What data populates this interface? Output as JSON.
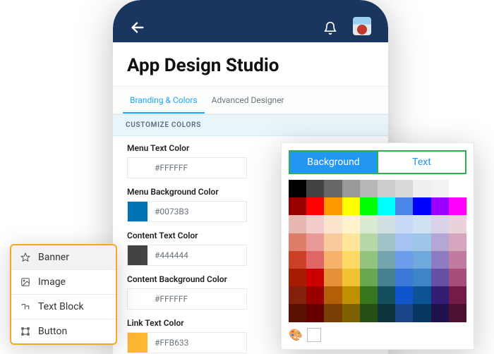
{
  "header": {
    "title": "App Design Studio"
  },
  "tabs": [
    {
      "label": "Branding & Colors",
      "active": true
    },
    {
      "label": "Advanced Designer",
      "active": false
    }
  ],
  "section_header": "CUSTOMIZE COLORS",
  "fields": [
    {
      "label": "Menu Text Color",
      "value": "#FFFFFF",
      "swatch": "#FFFFFF"
    },
    {
      "label": "Menu Background Color",
      "value": "#0073B3",
      "swatch": "#0073B3"
    },
    {
      "label": "Content Text Color",
      "value": "#444444",
      "swatch": "#444444"
    },
    {
      "label": "Content Background Color",
      "value": "#FFFFFF",
      "swatch": "#FFFFFF"
    },
    {
      "label": "Link Text Color",
      "value": "#FFB633",
      "swatch": "#FFB633"
    }
  ],
  "elements": [
    {
      "icon": "star-icon",
      "label": "Banner"
    },
    {
      "icon": "image-icon",
      "label": "Image"
    },
    {
      "icon": "text-icon",
      "label": "Text Block"
    },
    {
      "icon": "frame-icon",
      "label": "Button"
    }
  ],
  "picker": {
    "tabs": {
      "primary": "Background",
      "secondary": "Text"
    },
    "row1": [
      "#000000",
      "#434343",
      "#666666",
      "#999999",
      "#b7b7b7",
      "#cccccc",
      "#d9d9d9",
      "#efefef",
      "#f3f3f3",
      "#ffffff"
    ],
    "row2": [
      "#980000",
      "#ff0000",
      "#ff9900",
      "#ffff00",
      "#00ff00",
      "#00ffff",
      "#4a86e8",
      "#0000ff",
      "#9900ff",
      "#ff00ff"
    ],
    "shades": [
      [
        "#e6b8af",
        "#f4cccc",
        "#fce5cd",
        "#fff2cc",
        "#d9ead3",
        "#d0e0e3",
        "#c9daf8",
        "#cfe2f3",
        "#d9d2e9",
        "#ead1dc"
      ],
      [
        "#dd7e6b",
        "#ea9999",
        "#f9cb9c",
        "#ffe599",
        "#b6d7a8",
        "#a2c4c9",
        "#a4c2f4",
        "#9fc5e8",
        "#b4a7d6",
        "#d5a6bd"
      ],
      [
        "#cc4125",
        "#e06666",
        "#f6b26b",
        "#ffd966",
        "#93c47d",
        "#76a5af",
        "#6d9eeb",
        "#6fa8dc",
        "#8e7cc3",
        "#c27ba0"
      ],
      [
        "#a61c00",
        "#cc0000",
        "#e69138",
        "#f1c232",
        "#6aa84f",
        "#45818e",
        "#3c78d8",
        "#3d85c6",
        "#674ea7",
        "#a64d79"
      ],
      [
        "#85200c",
        "#990000",
        "#b45f06",
        "#bf9000",
        "#38761d",
        "#134f5c",
        "#1155cc",
        "#0b5394",
        "#351c75",
        "#741b47"
      ],
      [
        "#5b0f00",
        "#660000",
        "#783f04",
        "#7f6000",
        "#274e13",
        "#0c343d",
        "#1c4587",
        "#073763",
        "#20124d",
        "#4c1130"
      ]
    ]
  }
}
